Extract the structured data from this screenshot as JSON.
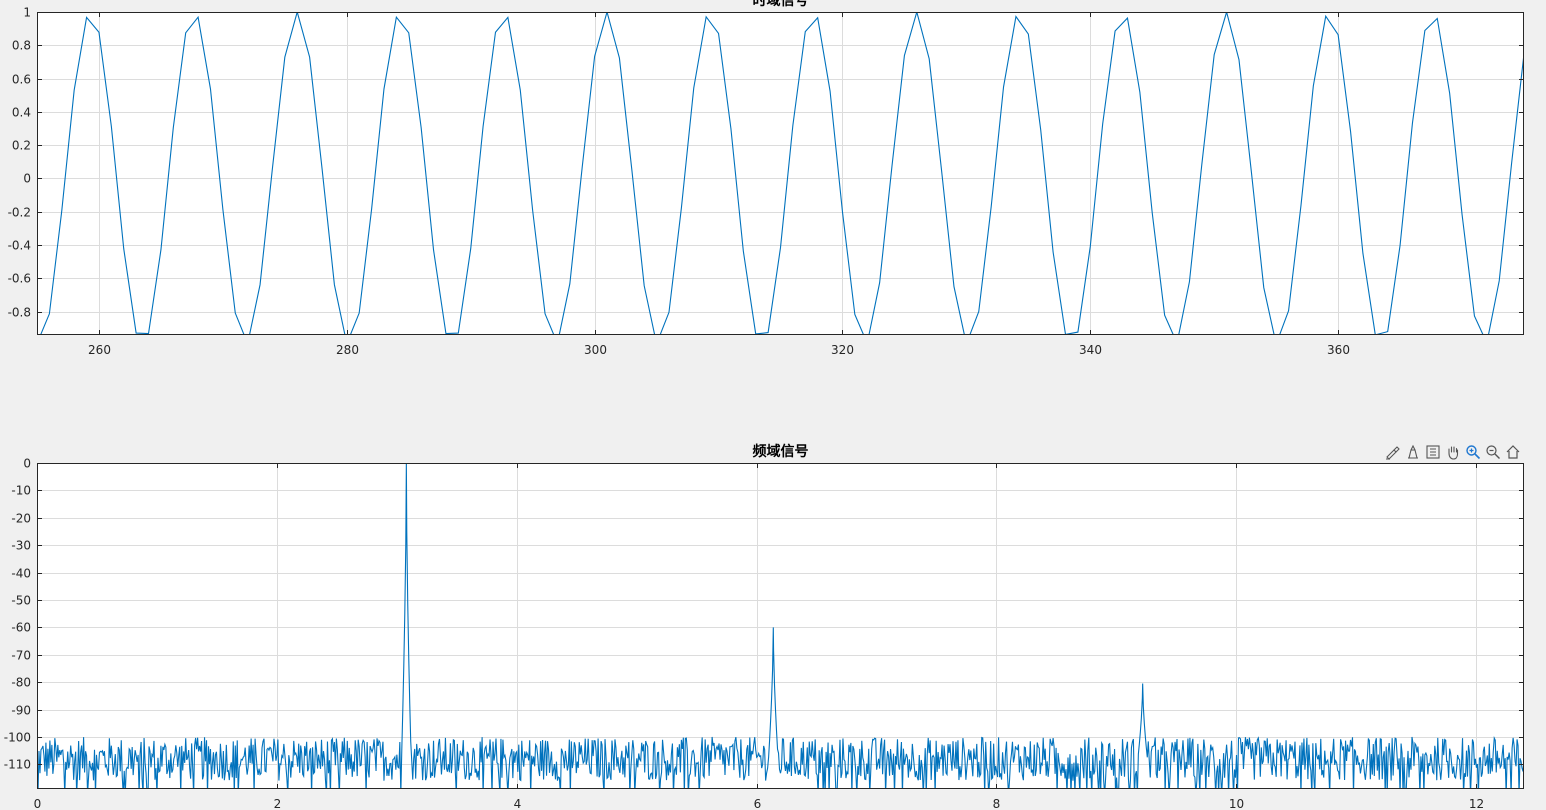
{
  "toolbar": {
    "icons": [
      "brush-icon",
      "data-tip-icon",
      "legend-icon",
      "pan-hand-icon",
      "zoom-in-icon",
      "zoom-out-icon",
      "home-icon"
    ]
  },
  "colors": {
    "line": "#0072BD",
    "grid": "#dcdcdc",
    "axes_bg": "#ffffff",
    "figure_bg": "#f0f0f0",
    "active_tool": "#1f77d0"
  },
  "chart_data": [
    {
      "type": "line",
      "title": "时域信号",
      "xlabel": "",
      "ylabel": "",
      "xlim": [
        255,
        375
      ],
      "ylim": [
        -0.94,
        1.0
      ],
      "xticks": [
        260,
        280,
        300,
        320,
        340,
        360
      ],
      "yticks": [
        -0.8,
        -0.6,
        -0.4,
        -0.2,
        0,
        0.2,
        0.4,
        0.6,
        0.8,
        1
      ],
      "ytick_labels": [
        "-0.8",
        "-0.6",
        "-0.4",
        "-0.2",
        "0",
        "0.2",
        "0.4",
        "0.6",
        "0.8",
        "1"
      ],
      "grid": true,
      "signal": {
        "kind": "cosine",
        "amplitude": 1.0,
        "period": 8.33,
        "peak_at": 276,
        "sample_step": 1,
        "x_start": 255,
        "x_end": 375
      }
    },
    {
      "type": "line",
      "title": "频域信号",
      "xlabel": "",
      "ylabel": "",
      "xlim": [
        0,
        12.4
      ],
      "ylim": [
        -119,
        0
      ],
      "xticks": [
        0,
        2,
        4,
        6,
        8,
        10,
        12
      ],
      "yticks": [
        0,
        -10,
        -20,
        -30,
        -40,
        -50,
        -60,
        -70,
        -80,
        -90,
        -100,
        -110
      ],
      "grid": true,
      "noise_floor": {
        "mean": -108,
        "spread": 8,
        "min": -119,
        "max": -98
      },
      "peaks": [
        {
          "x": 3.08,
          "y": 0
        },
        {
          "x": 6.14,
          "y": -60
        },
        {
          "x": 9.22,
          "y": -80.5
        }
      ]
    }
  ]
}
